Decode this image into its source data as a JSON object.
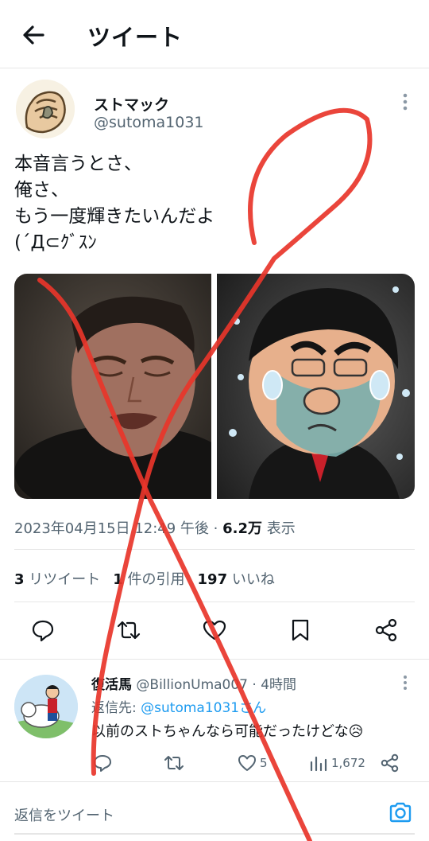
{
  "header": {
    "title": "ツイート"
  },
  "tweet": {
    "author_name": "ストマック",
    "author_handle": "@sutoma1031",
    "text_lines": [
      "本音言うとさ、",
      "俺さ、",
      "もう一度輝きたいんだよ",
      "(´Д⊂ｸﾞｽﾝ"
    ],
    "timestamp": "2023年04月15日 12:49 午後 · ",
    "views_count": "6.2万",
    "views_label": " 表示",
    "retweets_count": "3",
    "retweets_label": " リツイート",
    "quotes_count": "1",
    "quotes_label": " 件の引用",
    "likes_count": "197",
    "likes_label": " いいね"
  },
  "reply": {
    "name": "復活馬",
    "handle_time": " @BillionUma007 · 4時間",
    "reply_to_prefix": "返信先: ",
    "reply_to_link": "@sutoma1031さん",
    "text": "以前のストちゃんなら可能だったけどな😥",
    "like_count": "5",
    "view_count": "1,672"
  },
  "composer": {
    "placeholder": "返信をツイート"
  },
  "colors": {
    "accent": "#1d9bf0",
    "secondary_text": "#536471",
    "scribble": "#e8352a"
  },
  "icons": [
    "back-arrow-icon",
    "more-icon",
    "reply-icon",
    "retweet-icon",
    "like-icon",
    "bookmark-icon",
    "share-icon",
    "views-icon",
    "camera-icon"
  ]
}
